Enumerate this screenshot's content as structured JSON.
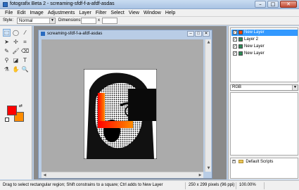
{
  "window": {
    "title": "fotografix Beta 2 - screaming-sfdf-f-a-afdf-asdas",
    "min_label": "–",
    "max_label": "□",
    "close_label": "✕"
  },
  "menu": [
    "File",
    "Edit",
    "Image",
    "Adjustments",
    "Layer",
    "Filter",
    "Select",
    "View",
    "Window",
    "Help"
  ],
  "options": {
    "style_label": "Style:",
    "style_value": "Normal",
    "dimensions_label": "Dimensions:",
    "times": "x"
  },
  "document": {
    "title": "screaming-sfdf-f-a-afdf-asdas",
    "min_label": "–",
    "max_label": "□",
    "close_label": "✕"
  },
  "layers": [
    {
      "name": "New Layer",
      "selected": true,
      "checked": "✓"
    },
    {
      "name": "Layer 2",
      "selected": false,
      "checked": "✓"
    },
    {
      "name": "New Layer",
      "selected": false,
      "checked": "✓"
    },
    {
      "name": "New Layer",
      "selected": false,
      "checked": "✓"
    }
  ],
  "histogram": {
    "channel": "RGB"
  },
  "scripts": {
    "expander": "+",
    "folder": "Default Scripts"
  },
  "status": {
    "hint": "Drag to select rectangular region; Shift constrains to a square; Ctrl adds to New Layer",
    "size": "250 x 299 pixels (96 ppi)",
    "zoom": "100.00%"
  },
  "colors": {
    "foreground": "#ff0000",
    "background": "#ff8c00",
    "selection": "#3399ff"
  }
}
